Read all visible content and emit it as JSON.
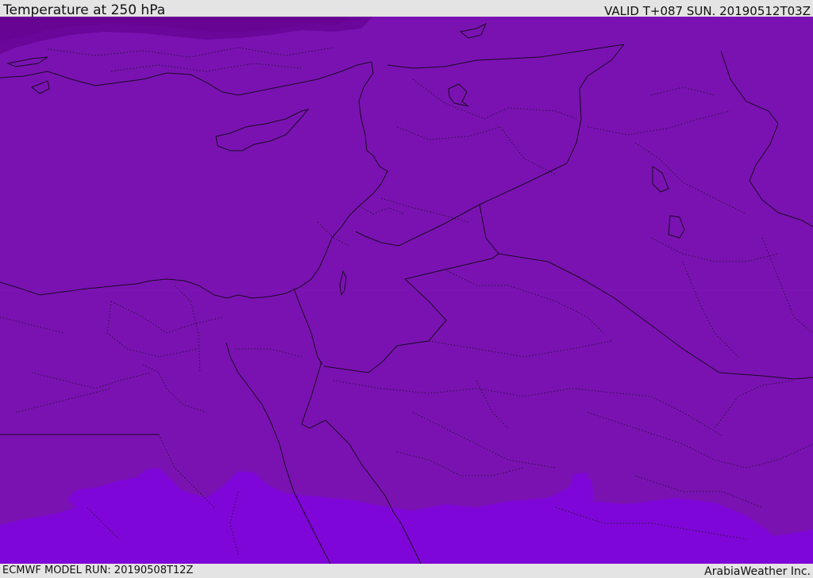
{
  "header": {
    "title": "Temperature at 250 hPa",
    "valid": "VALID T+087 SUN. 20190512T03Z"
  },
  "footer": {
    "model_run": "ECMWF MODEL RUN: 20190508T12Z",
    "credit": "ArabiaWeather Inc."
  },
  "colors": {
    "base_field": "#7a12b2",
    "cold_field": "#6a0699",
    "cold_field_inner": "#680493",
    "warm_field": "#7f06d8",
    "coastline": "#1a0a22",
    "border": "#1a0a22",
    "internal_border": "#2a1235"
  }
}
